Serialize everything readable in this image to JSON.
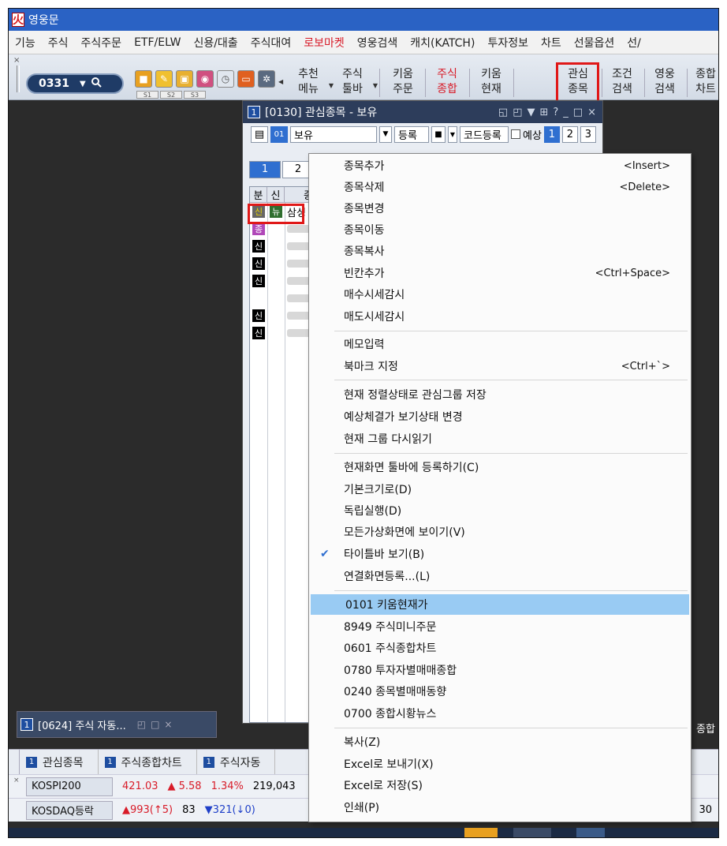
{
  "app": {
    "title": "영웅문"
  },
  "menu": [
    "기능",
    "주식",
    "주식주문",
    "ETF/ELW",
    "신용/대출",
    "주식대여",
    "로보마켓",
    "영웅검색",
    "캐치(KATCH)",
    "투자정보",
    "차트",
    "선물옵션",
    "선/"
  ],
  "toolbar": {
    "screen_code": "0331",
    "s_tabs": [
      "S1",
      "S2",
      "S3"
    ],
    "buttons": [
      {
        "l1": "추천",
        "l2": "메뉴"
      },
      {
        "l1": "주식",
        "l2": "툴바"
      },
      {
        "l1": "키움",
        "l2": "주문"
      },
      {
        "l1": "주식",
        "l2": "종합"
      },
      {
        "l1": "키움",
        "l2": "현재"
      },
      {
        "l1": "관심",
        "l2": "종목"
      },
      {
        "l1": "조건",
        "l2": "검색"
      },
      {
        "l1": "영웅",
        "l2": "검색"
      },
      {
        "l1": "종합",
        "l2": "차트"
      }
    ]
  },
  "watchlist": {
    "badge": "1",
    "title": "[0130] 관심종목 - 보유",
    "group_icon": "01",
    "group": "보유",
    "register": "등록",
    "code_register": "코드등록",
    "forecast": "예상",
    "pages": [
      "1",
      "2",
      "3"
    ],
    "tabs": [
      "1",
      "2"
    ],
    "head": [
      "분",
      "신",
      "종"
    ],
    "first_row": {
      "tag1": "신",
      "tag2": "뉴",
      "name": "삼성"
    },
    "rows": [
      {
        "tag": "종"
      },
      {
        "tag": "신"
      },
      {
        "tag": "신"
      },
      {
        "tag": "신"
      },
      {
        "tag": ""
      },
      {
        "tag": "신"
      },
      {
        "tag": "신"
      }
    ]
  },
  "mini_window": {
    "badge": "1",
    "title": "[0624] 주식 자동..."
  },
  "bottom_tabs": [
    {
      "n": "1",
      "label": "관심종목"
    },
    {
      "n": "1",
      "label": "주식종합차트"
    },
    {
      "n": "1",
      "label": "주식자동"
    }
  ],
  "ticker": {
    "row1": {
      "label": "KOSPI200",
      "v1": "421.03",
      "v2": "▲ 5.58",
      "v3": "1.34%",
      "v4": "219,043"
    },
    "row2": {
      "label": "KOSDAQ등락",
      "v1": "▲993(↑5)",
      "v2": "83",
      "v3": "▼321(↓0)",
      "right": "30"
    },
    "right_label": "종합"
  },
  "context_menu": [
    {
      "label": "종목추가",
      "shortcut": "<Insert>"
    },
    {
      "label": "종목삭제",
      "shortcut": "<Delete>"
    },
    {
      "label": "종목변경",
      "shortcut": ""
    },
    {
      "label": "종목이동",
      "shortcut": ""
    },
    {
      "label": "종목복사",
      "shortcut": ""
    },
    {
      "label": "빈칸추가",
      "shortcut": "<Ctrl+Space>"
    },
    {
      "label": "매수시세감시",
      "shortcut": ""
    },
    {
      "label": "매도시세감시",
      "shortcut": ""
    },
    {
      "label": "메모입력",
      "shortcut": ""
    },
    {
      "label": "북마크 지정",
      "shortcut": "<Ctrl+`>"
    },
    {
      "label": "현재 정렬상태로 관심그룹 저장",
      "shortcut": ""
    },
    {
      "label": "예상체결가 보기상태 변경",
      "shortcut": ""
    },
    {
      "label": "현재 그룹 다시읽기",
      "shortcut": ""
    },
    {
      "label": "현재화면 툴바에 등록하기(C)",
      "shortcut": ""
    },
    {
      "label": "기본크기로(D)",
      "shortcut": ""
    },
    {
      "label": "독립실행(D)",
      "shortcut": ""
    },
    {
      "label": "모든가상화면에 보이기(V)",
      "shortcut": ""
    },
    {
      "label": "타이틀바 보기(B)",
      "shortcut": "",
      "checked": true
    },
    {
      "label": "연결화면등록...(L)",
      "shortcut": ""
    },
    {
      "label": "0101 키움현재가",
      "shortcut": "",
      "highlighted": true
    },
    {
      "label": "8949 주식미니주문",
      "shortcut": ""
    },
    {
      "label": "0601 주식종합차트",
      "shortcut": ""
    },
    {
      "label": "0780 투자자별매매종합",
      "shortcut": ""
    },
    {
      "label": "0240 종목별매매동향",
      "shortcut": ""
    },
    {
      "label": "0700 종합시황뉴스",
      "shortcut": ""
    },
    {
      "label": "복사(Z)",
      "shortcut": ""
    },
    {
      "label": "Excel로 보내기(X)",
      "shortcut": ""
    },
    {
      "label": "Excel로 저장(S)",
      "shortcut": ""
    },
    {
      "label": "인쇄(P)",
      "shortcut": ""
    }
  ],
  "colors": {
    "title_blue": "#2a62c4",
    "accent_red": "#d81b28",
    "highlight": "#99cbf3",
    "dark_bg": "#2b2b2b"
  }
}
